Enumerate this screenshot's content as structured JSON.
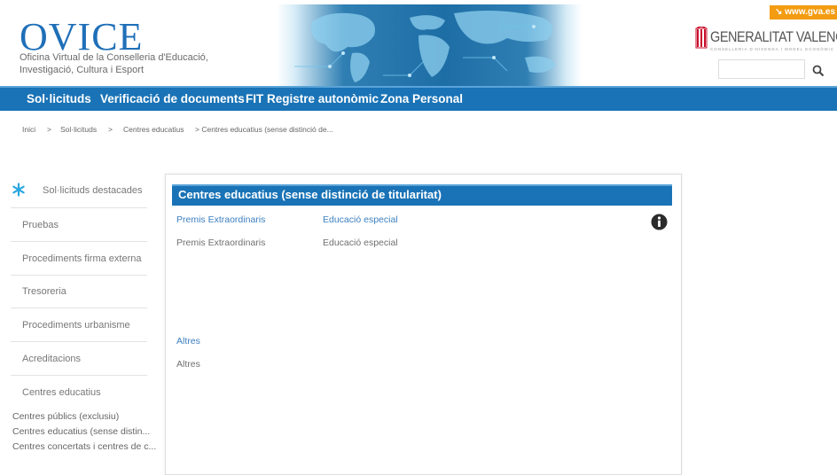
{
  "header": {
    "logo_text": "OVICE",
    "logo_subtitle": "Oficina Virtual de la Conselleria d'Educació, Investigació, Cultura i Esport",
    "gva_link": "↘ www.gva.es",
    "generalitat_name": "GENERALITAT VALENCIANA",
    "generalitat_sub": "CONSELLERIA D'HISENDA I MODEL ECONÒMIC",
    "search_value": "",
    "search_icon": "search-icon"
  },
  "nav": {
    "items": [
      {
        "label": "Sol·licituds"
      },
      {
        "label": "Verificació de documents"
      },
      {
        "label": "FIT Registre autonòmic"
      },
      {
        "label": "Zona Personal"
      }
    ]
  },
  "breadcrumb": {
    "items": [
      "Inici",
      ">",
      "Sol·licituds",
      ">",
      "Centres educatius",
      "> Centres educatius (sense distinció de..."
    ]
  },
  "sidebar": {
    "featured": "Sol·licituds destacades",
    "items": [
      {
        "label": "Pruebas"
      },
      {
        "label": "Procediments firma externa"
      },
      {
        "label": "Tresoreria"
      },
      {
        "label": "Procediments urbanisme"
      },
      {
        "label": "Acreditacions"
      },
      {
        "label": "Centres educatius"
      }
    ],
    "subitems": [
      {
        "label": "Centres públics (exclusiu)"
      },
      {
        "label": "Centres educatius (sense distin..."
      },
      {
        "label": "Centres concertats i centres de c..."
      }
    ]
  },
  "main": {
    "title": "Centres educatius (sense distinció de titularitat)",
    "categories": [
      {
        "heading": "Premis Extraordinaris",
        "link": "Premis Extraordinaris"
      },
      {
        "heading": "Educació especial",
        "link": "Educació especial"
      },
      {
        "heading": "Altres",
        "link": "Altres"
      }
    ],
    "info_icon": "info-icon"
  },
  "colors": {
    "primary": "#1a73b6",
    "accent_orange": "#f39c12",
    "logo_blue": "#1f6fb8"
  }
}
